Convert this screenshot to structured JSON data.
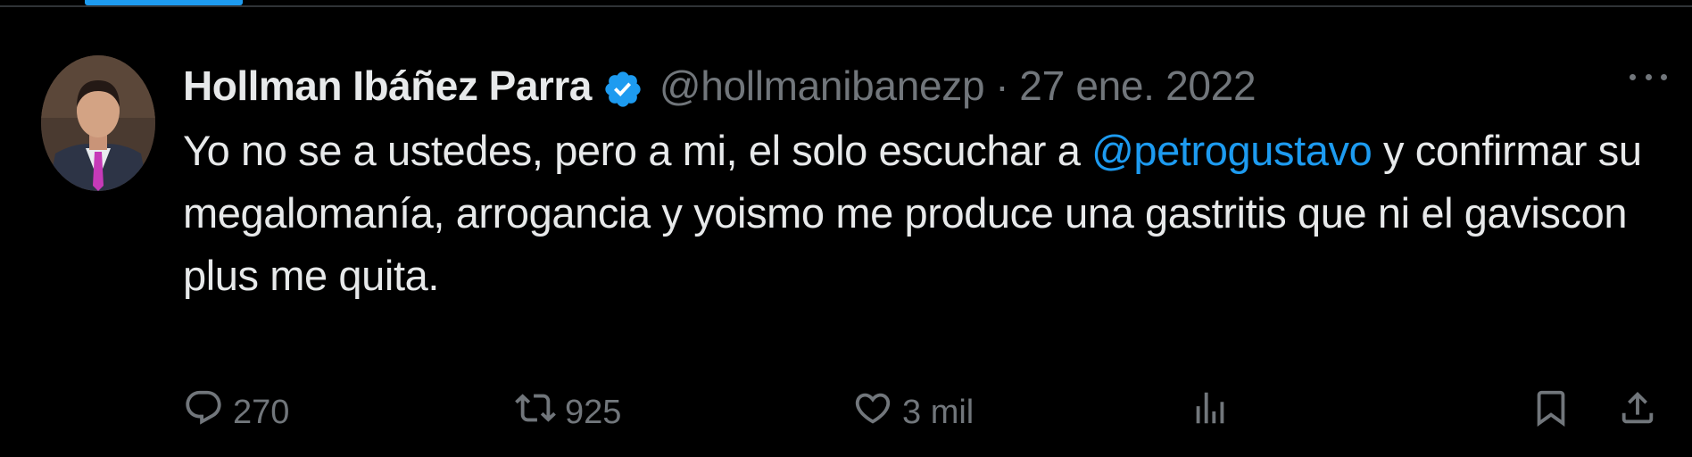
{
  "tweet": {
    "author_name": "Hollman Ibáñez Parra",
    "handle": "@hollmanibanezp",
    "separator": "·",
    "date": "27 ene. 2022",
    "text_before_mention": "Yo no se a ustedes, pero a mi, el solo escuchar a ",
    "mention": "@petrogustavo",
    "text_after_mention": " y confirmar su megalomanía, arrogancia y yoismo me produce una gastritis que ni el gaviscon plus me quita."
  },
  "actions": {
    "replies": "270",
    "retweets": "925",
    "likes": "3 mil"
  },
  "icons": {
    "verified": "verified-badge-icon",
    "more": "more-options-icon",
    "reply": "reply-icon",
    "retweet": "retweet-icon",
    "like": "heart-icon",
    "views": "views-chart-icon",
    "bookmark": "bookmark-icon",
    "share": "share-icon"
  },
  "colors": {
    "background": "#000000",
    "text_primary": "#e7e9ea",
    "text_secondary": "#71767b",
    "accent": "#1d9bf0"
  }
}
